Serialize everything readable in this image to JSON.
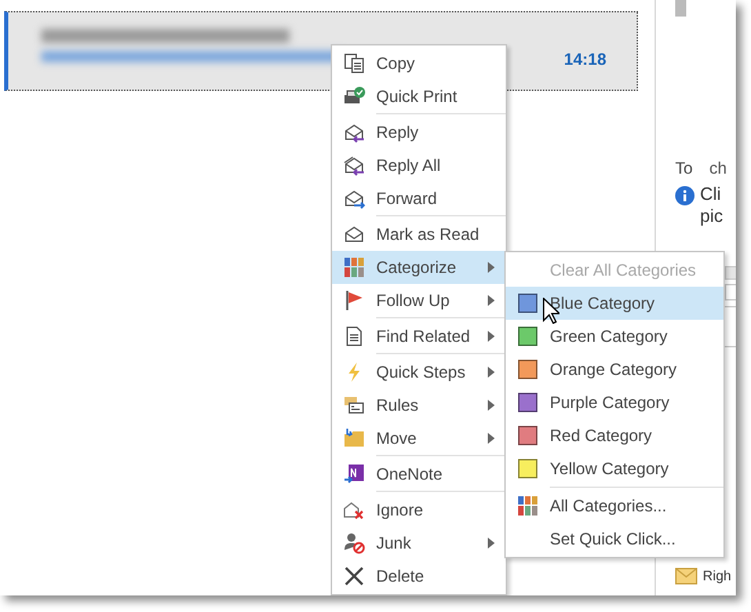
{
  "message": {
    "time": "14:18",
    "selected": true
  },
  "reading_pane": {
    "to_label": "To",
    "recipient": "ch",
    "info_lines": [
      "Cli",
      "pic"
    ],
    "footer": "Righ"
  },
  "context_menu": {
    "items": [
      {
        "label": "Copy",
        "submenu": false,
        "selected": false,
        "separator_before": false
      },
      {
        "label": "Quick Print",
        "submenu": false,
        "selected": false,
        "separator_before": false
      },
      {
        "label": "Reply",
        "submenu": false,
        "selected": false,
        "separator_before": true
      },
      {
        "label": "Reply All",
        "submenu": false,
        "selected": false,
        "separator_before": false
      },
      {
        "label": "Forward",
        "submenu": false,
        "selected": false,
        "separator_before": false
      },
      {
        "label": "Mark as Read",
        "submenu": false,
        "selected": false,
        "separator_before": true
      },
      {
        "label": "Categorize",
        "submenu": true,
        "selected": true,
        "separator_before": false
      },
      {
        "label": "Follow Up",
        "submenu": true,
        "selected": false,
        "separator_before": false
      },
      {
        "label": "Find Related",
        "submenu": true,
        "selected": false,
        "separator_before": true
      },
      {
        "label": "Quick Steps",
        "submenu": true,
        "selected": false,
        "separator_before": true
      },
      {
        "label": "Rules",
        "submenu": true,
        "selected": false,
        "separator_before": false
      },
      {
        "label": "Move",
        "submenu": true,
        "selected": false,
        "separator_before": false
      },
      {
        "label": "OneNote",
        "submenu": false,
        "selected": false,
        "separator_before": true
      },
      {
        "label": "Ignore",
        "submenu": false,
        "selected": false,
        "separator_before": true
      },
      {
        "label": "Junk",
        "submenu": true,
        "selected": false,
        "separator_before": false
      },
      {
        "label": "Delete",
        "submenu": false,
        "selected": false,
        "separator_before": false
      }
    ]
  },
  "categorize_submenu": {
    "items": [
      {
        "kind": "clear",
        "label": "Clear All Categories",
        "selected": false,
        "disabled": true
      },
      {
        "kind": "category",
        "label": "Blue Category",
        "color": "#6f96dc",
        "selected": true,
        "disabled": false
      },
      {
        "kind": "category",
        "label": "Green Category",
        "color": "#6cc96a",
        "selected": false,
        "disabled": false
      },
      {
        "kind": "category",
        "label": "Orange Category",
        "color": "#f2995a",
        "selected": false,
        "disabled": false
      },
      {
        "kind": "category",
        "label": "Purple Category",
        "color": "#9a70cc",
        "selected": false,
        "disabled": false
      },
      {
        "kind": "category",
        "label": "Red Category",
        "color": "#e07c80",
        "selected": false,
        "disabled": false
      },
      {
        "kind": "category",
        "label": "Yellow Category",
        "color": "#f7ee5e",
        "selected": false,
        "disabled": false
      },
      {
        "kind": "all",
        "label": "All Categories...",
        "selected": false,
        "disabled": false
      },
      {
        "kind": "quick",
        "label": "Set Quick Click...",
        "selected": false,
        "disabled": false
      }
    ]
  }
}
